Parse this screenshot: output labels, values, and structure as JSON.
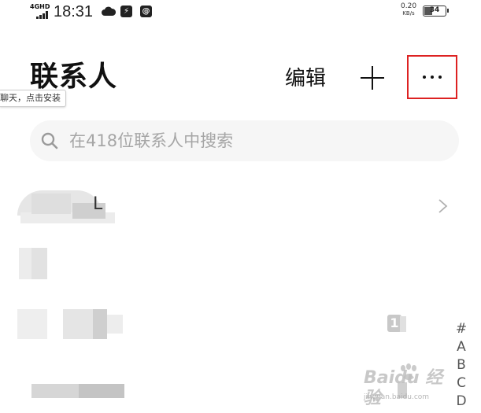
{
  "status_bar": {
    "network": "4GHD",
    "time": "18:31",
    "speed": "0.20",
    "speed_unit": "KB/s",
    "battery": "34"
  },
  "header": {
    "title": "联系人",
    "edit_label": "编辑",
    "tooltip": "聊天，点击安装"
  },
  "search": {
    "placeholder": "在418位联系人中搜索"
  },
  "contacts": {
    "first_row_text": "L"
  },
  "badge_text": "1",
  "index_letters": [
    "#",
    "A",
    "B",
    "C",
    "D"
  ],
  "watermark": {
    "brand": "Baidu 经验",
    "sub": "jingyan.baidu.com"
  },
  "colors": {
    "highlight_border": "#dd2222",
    "search_bg": "#f6f6f6",
    "placeholder": "#a6a6a6"
  }
}
